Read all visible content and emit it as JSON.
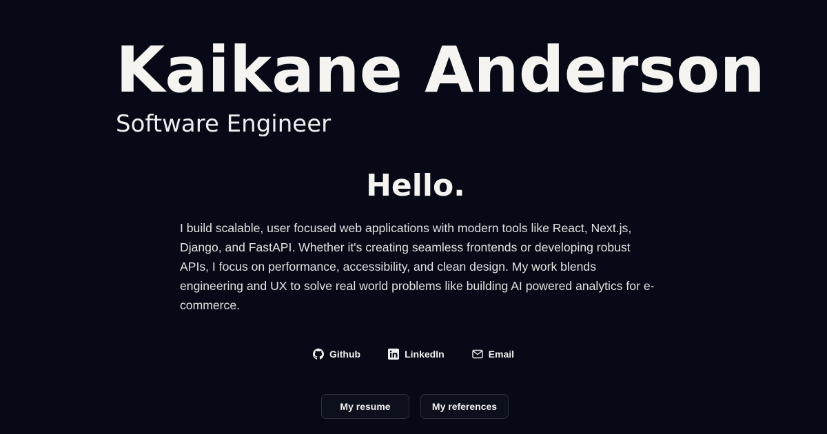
{
  "header": {
    "name": "Kaikane Anderson",
    "role": "Software Engineer"
  },
  "intro": {
    "heading": "Hello.",
    "bio": "I build scalable, user focused web applications with modern tools like React, Next.js, Django, and FastAPI. Whether it's creating seamless frontends or developing robust APIs, I focus on performance, accessibility, and clean design. My work blends engineering and UX to solve real world problems like building AI powered analytics for e-commerce."
  },
  "links": [
    {
      "label": "Github",
      "icon": "github-icon"
    },
    {
      "label": "LinkedIn",
      "icon": "linkedin-icon"
    },
    {
      "label": "Email",
      "icon": "mail-icon"
    }
  ],
  "buttons": {
    "resume_label": "My resume",
    "references_label": "My references"
  },
  "colors": {
    "background": "#070a16",
    "text": "#f5f4f1",
    "button_border": "#2b2f3d"
  }
}
